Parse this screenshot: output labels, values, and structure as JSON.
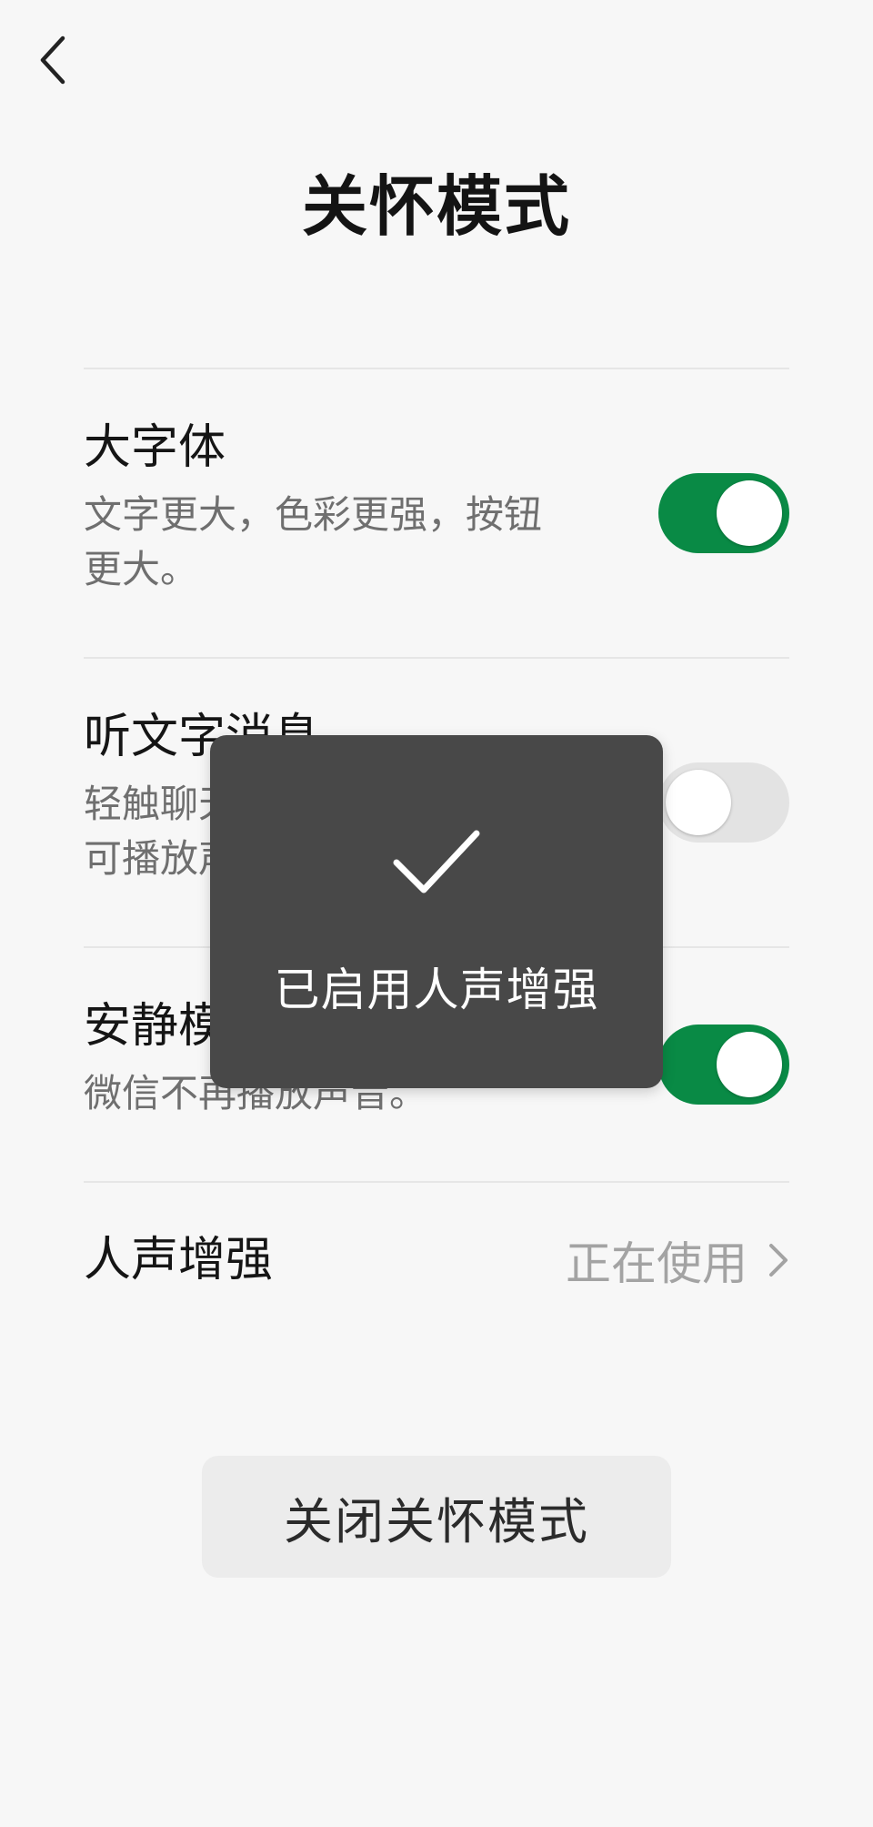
{
  "header": {
    "back_icon": "chevron-left-icon",
    "title": "关怀模式"
  },
  "settings": [
    {
      "title": "大字体",
      "description": "文字更大，色彩更强，按钮更大。",
      "toggle": "on"
    },
    {
      "title": "听文字消息",
      "description": "轻触聊天中的文字消息，即可播放声音。",
      "toggle": "off"
    },
    {
      "title": "安静模式",
      "description": "微信不再播放声音。",
      "toggle": "on"
    }
  ],
  "voice_enhance": {
    "title": "人声增强",
    "status": "正在使用",
    "chevron_icon": "chevron-right-icon"
  },
  "close_button": {
    "label": "关闭关怀模式"
  },
  "toast": {
    "icon": "checkmark-icon",
    "message": "已启用人声增强"
  },
  "colors": {
    "toggle_on": "#098a45",
    "toggle_off": "#e3e3e3",
    "toast_bg": "#484848",
    "background": "#f7f7f7"
  }
}
